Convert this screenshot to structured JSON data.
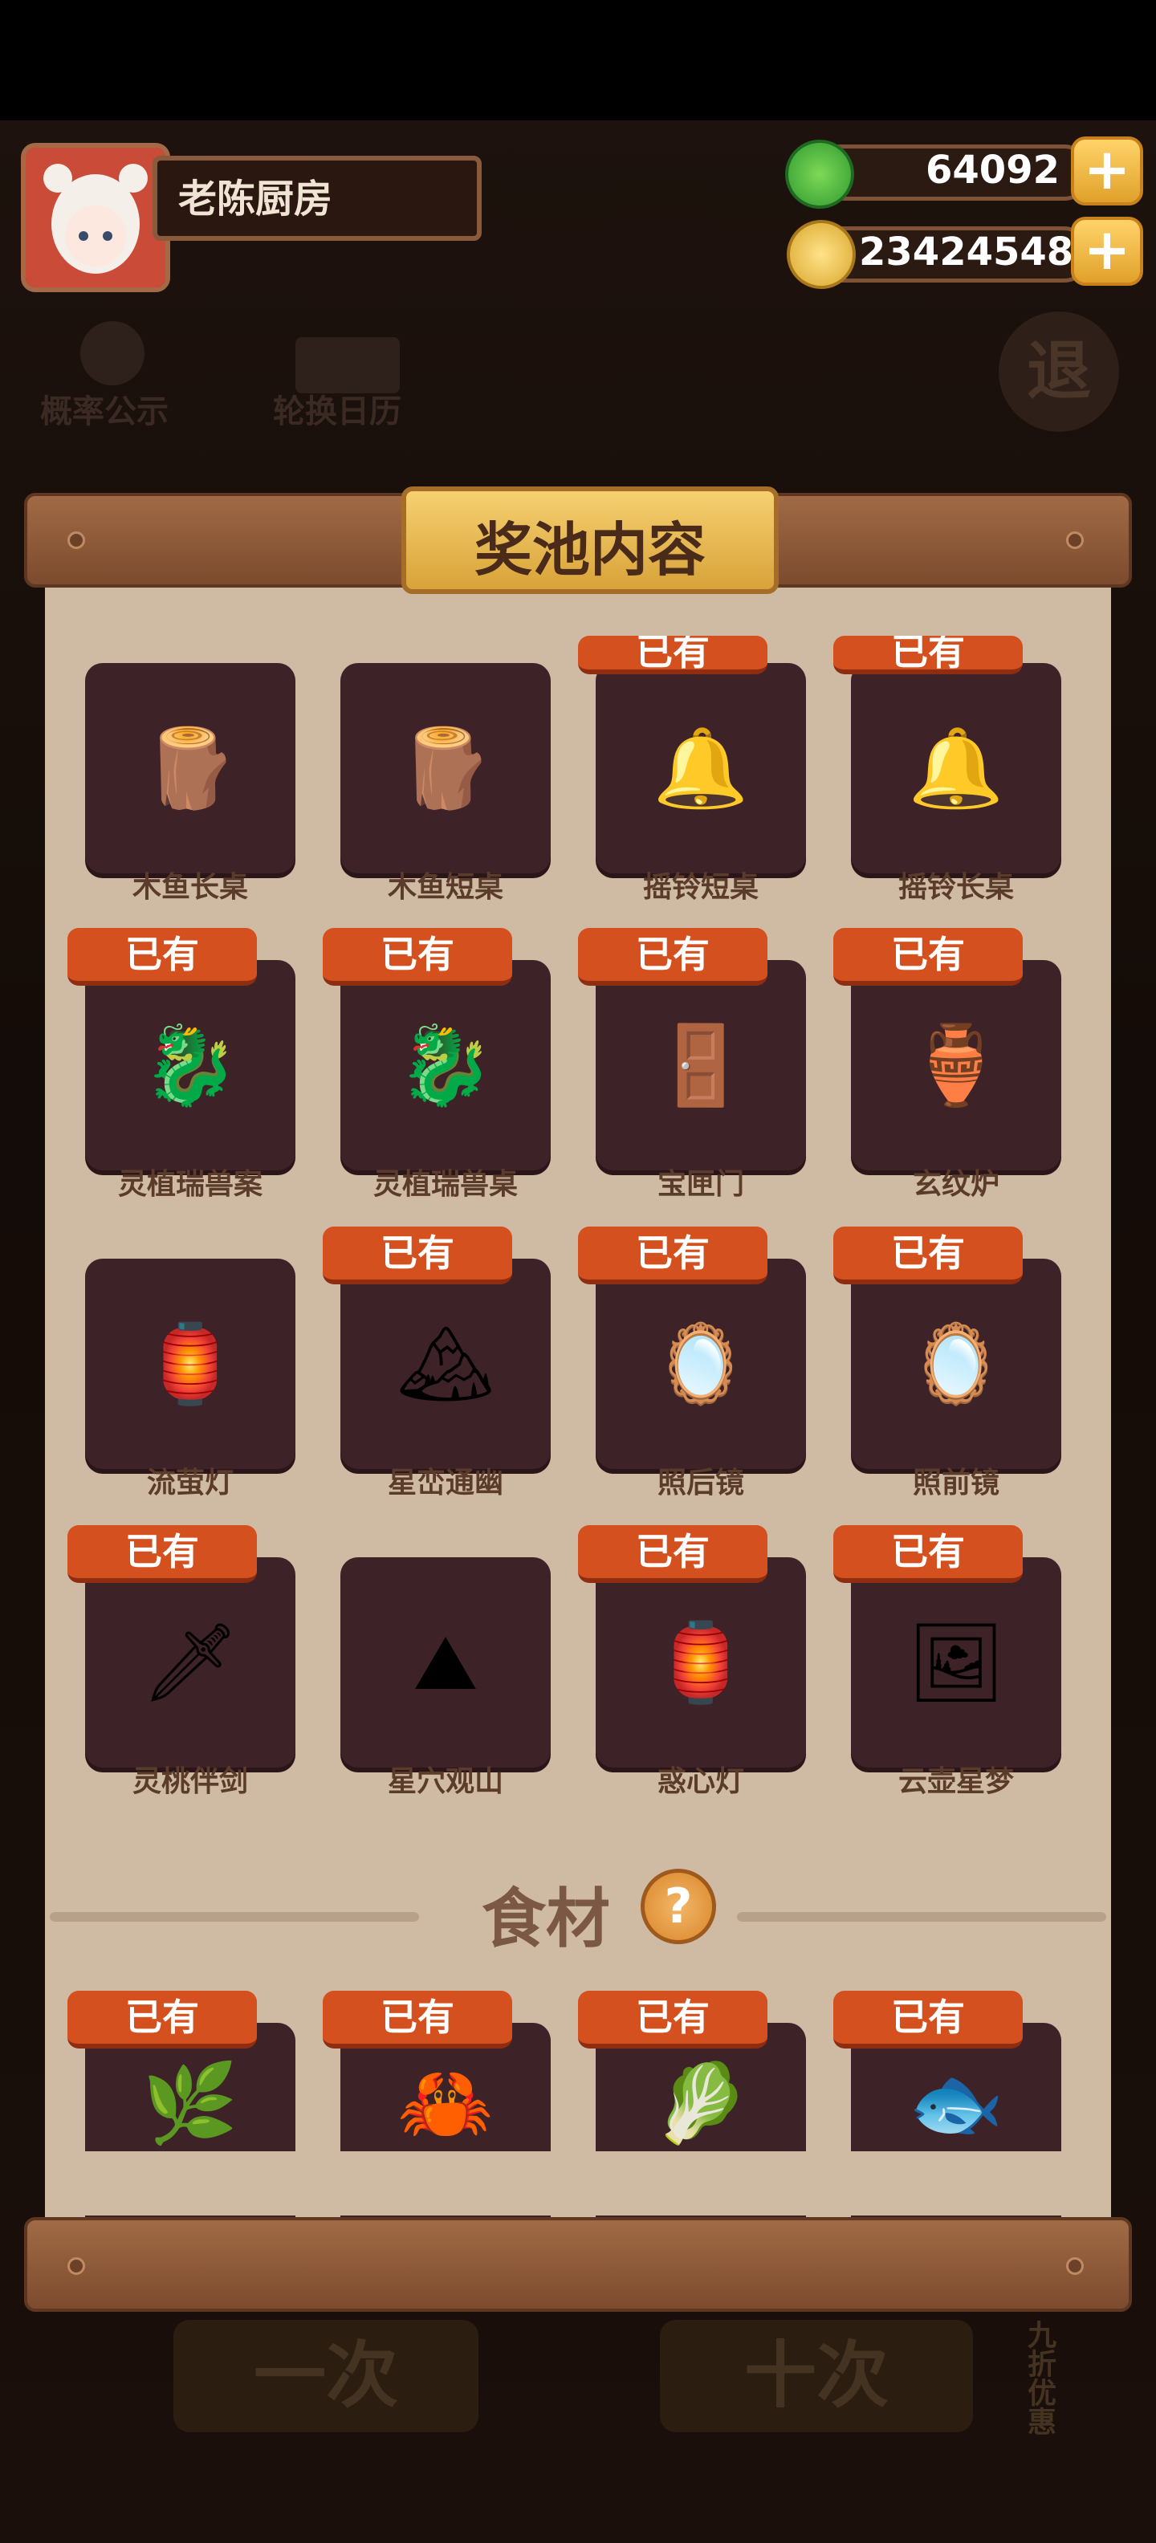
{
  "header": {
    "player_name": "老陈厨房",
    "jade_amount": "64092",
    "coin_amount": "23424548",
    "add_label": "+"
  },
  "background_buttons": {
    "probability": "概率公示",
    "calendar": "轮换日历",
    "exit": "退"
  },
  "panel": {
    "title": "奖池内容",
    "owned_badge": "已有",
    "items": [
      {
        "label": "木鱼长桌",
        "owned": false,
        "icon": "table-icon"
      },
      {
        "label": "木鱼短桌",
        "owned": false,
        "icon": "table-icon"
      },
      {
        "label": "摇铃短桌",
        "owned": true,
        "icon": "bell-table-icon"
      },
      {
        "label": "摇铃长桌",
        "owned": true,
        "icon": "bell-table-icon"
      },
      {
        "label": "灵植瑞兽案",
        "owned": true,
        "icon": "beast-table-icon"
      },
      {
        "label": "灵植瑞兽桌",
        "owned": true,
        "icon": "beast-table-icon"
      },
      {
        "label": "宝匣门",
        "owned": true,
        "icon": "treasure-door-icon"
      },
      {
        "label": "玄纹炉",
        "owned": true,
        "icon": "incense-burner-icon"
      },
      {
        "label": "流萤灯",
        "owned": false,
        "icon": "lantern-icon"
      },
      {
        "label": "星峦通幽",
        "owned": true,
        "icon": "mountain-painting-icon"
      },
      {
        "label": "照后镜",
        "owned": true,
        "icon": "mirror-icon"
      },
      {
        "label": "照前镜",
        "owned": true,
        "icon": "mirror-icon"
      },
      {
        "label": "灵桃伴剑",
        "owned": true,
        "icon": "peach-sword-icon"
      },
      {
        "label": "星穴观山",
        "owned": false,
        "icon": "cave-painting-icon"
      },
      {
        "label": "惑心灯",
        "owned": true,
        "icon": "golden-lantern-icon"
      },
      {
        "label": "云壶星梦",
        "owned": true,
        "icon": "star-dream-painting-icon"
      }
    ],
    "food_section_title": "食材",
    "help_label": "?",
    "food_items": [
      {
        "owned": true,
        "icon": "tea-leaf-icon"
      },
      {
        "owned": true,
        "icon": "crab-icon"
      },
      {
        "owned": true,
        "icon": "bamboo-shoot-icon"
      },
      {
        "owned": true,
        "icon": "fish-fin-icon"
      }
    ]
  },
  "bottom_buttons": {
    "single": "一次",
    "ten": "十次",
    "discount": "九折优惠"
  }
}
